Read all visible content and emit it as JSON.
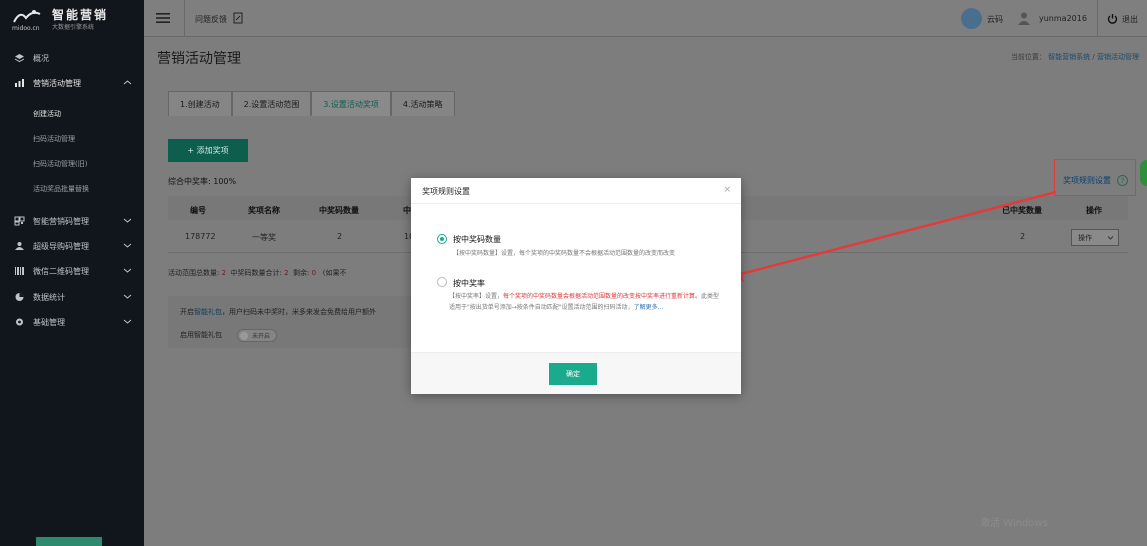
{
  "sidebar": {
    "brand_en": "midoo.cn",
    "brand_title": "智能营销",
    "brand_sub": "大数据引擎系统",
    "items": [
      {
        "label": "概况",
        "icon": "layers-icon"
      },
      {
        "label": "营销活动管理",
        "icon": "chart-icon"
      },
      {
        "label": "智能营销码管理",
        "icon": "qrcode-icon"
      },
      {
        "label": "超级导购码管理",
        "icon": "users-icon"
      },
      {
        "label": "微信二维码管理",
        "icon": "barcode-icon"
      },
      {
        "label": "数据统计",
        "icon": "pie-icon"
      },
      {
        "label": "基础管理",
        "icon": "gear-icon"
      }
    ],
    "sub_items": [
      "创建活动",
      "扫码活动管理",
      "扫码活动管理(旧)",
      "活动奖品批量替换"
    ]
  },
  "topbar": {
    "feedback": "问题反馈",
    "yunma": "云码",
    "user": "yunma2016",
    "logout": "退出"
  },
  "page": {
    "title": "营销活动管理",
    "crumb_prefix": "当前位置：",
    "crumb_1": "智能营销系统",
    "crumb_sep": "/",
    "crumb_2": "营销活动管理"
  },
  "tabs": [
    "1.创建活动",
    "2.设置活动范围",
    "3.设置活动奖项",
    "4.活动策略"
  ],
  "content": {
    "add_button": "+ 添加奖项",
    "rate_label": "综合中奖率: 100%",
    "rule_link": "奖项规则设置",
    "rule_q": "?",
    "columns": [
      "编号",
      "奖项名称",
      "中奖码数量",
      "中",
      "已中奖数量",
      "操作"
    ],
    "row": {
      "id": "178772",
      "name": "一等奖",
      "count": "2",
      "partial": "10",
      "won": "2",
      "op": "操作"
    },
    "stats_a": "活动范围总数量:",
    "stats_a_val": "2",
    "stats_b": "中奖码数量合计:",
    "stats_b_val": "2",
    "stats_c": "剩余:",
    "stats_c_val": "0",
    "stats_d": "(如果不",
    "gift_prefix": "开启",
    "gift_link": "智能礼包",
    "gift_suffix": "，用户扫码未中奖时，米多来发会免费给用户额外",
    "gift_enable": "启用智能礼包",
    "toggle": "未开启"
  },
  "modal": {
    "title": "奖项规则设置",
    "close": "×",
    "opt1_label": "按中奖码数量",
    "opt1_desc": "【按中奖码数量】设置，每个奖项的中奖码数量不会根据活动范围数量的改变而改变",
    "opt2_label": "按中奖率",
    "opt2_desc_a": "【按中奖率】设置，",
    "opt2_desc_red": "每个奖项的中奖码数量会根据活动范围数量的改变按中奖率进行重新计算。",
    "opt2_desc_b": "此类型适用于\"按出货单号添加→按条件自动匹配\"设置活动范围的扫码活动，",
    "opt2_more": "了解更多...",
    "ok": "确定"
  },
  "watermark": "激活 Windows",
  "colors": {
    "accent": "#1aaa8c",
    "annotation": "#e23b3b"
  }
}
